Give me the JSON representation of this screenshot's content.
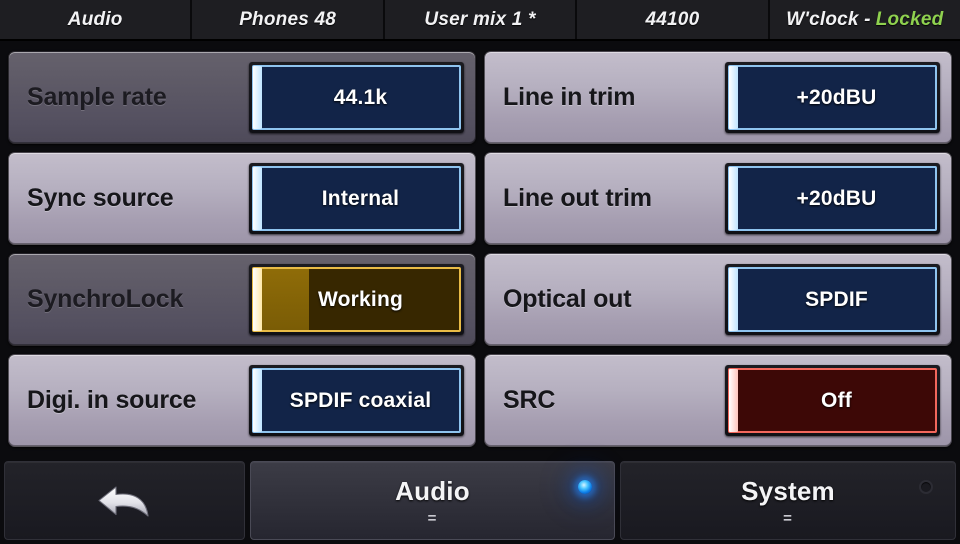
{
  "statusbar": {
    "segments": [
      {
        "name": "mode",
        "text": "Audio"
      },
      {
        "name": "output",
        "text": "Phones 48"
      },
      {
        "name": "mix",
        "text": "User mix 1 *"
      },
      {
        "name": "samplerate",
        "text": "44100"
      }
    ],
    "clock": {
      "label": "W'clock - ",
      "state": "Locked",
      "state_color": "#8fd14f"
    }
  },
  "settings": {
    "left_column": [
      {
        "name": "sample-rate",
        "label": "Sample rate",
        "value": "44.1k",
        "style": "blue",
        "panel": "dark",
        "fill_percent": 0
      },
      {
        "name": "sync-source",
        "label": "Sync source",
        "value": "Internal",
        "style": "blue",
        "panel": "light",
        "fill_percent": 0
      },
      {
        "name": "synchrolock",
        "label": "SynchroLock",
        "value": "Working",
        "style": "amber",
        "panel": "dark",
        "fill_percent": 27
      },
      {
        "name": "digi-in-source",
        "label": "Digi. in source",
        "value": "SPDIF coaxial",
        "style": "blue",
        "panel": "light",
        "fill_percent": 0
      }
    ],
    "right_column": [
      {
        "name": "line-in-trim",
        "label": "Line in trim",
        "value": "+20dBU",
        "style": "blue",
        "panel": "light",
        "fill_percent": 0
      },
      {
        "name": "line-out-trim",
        "label": "Line out trim",
        "value": "+20dBU",
        "style": "blue",
        "panel": "light",
        "fill_percent": 0
      },
      {
        "name": "optical-out",
        "label": "Optical out",
        "value": "SPDIF",
        "style": "blue",
        "panel": "light",
        "fill_percent": 0
      },
      {
        "name": "src",
        "label": "SRC",
        "value": "Off",
        "style": "red",
        "panel": "light",
        "fill_percent": 0
      }
    ]
  },
  "navbar": {
    "back": {
      "icon": "back-arrow-icon"
    },
    "tabs": [
      {
        "name": "audio",
        "label": "Audio",
        "sub": "=",
        "led": "on"
      },
      {
        "name": "system",
        "label": "System",
        "sub": "=",
        "led": "off"
      }
    ]
  },
  "colors": {
    "accent_green": "#8fd14f",
    "blue_border": "#8fc4ef",
    "blue_fill": "#122448",
    "amber_border": "#e8bb46",
    "amber_fill": "#372700",
    "amber_progress": "#8f6c08",
    "red_border": "#f2675c",
    "red_fill": "#3d0806",
    "panel_light": "#b6b0c0",
    "panel_dark": "#5c5865",
    "led_on": "#49c5ff",
    "background": "#0b0b0e"
  }
}
